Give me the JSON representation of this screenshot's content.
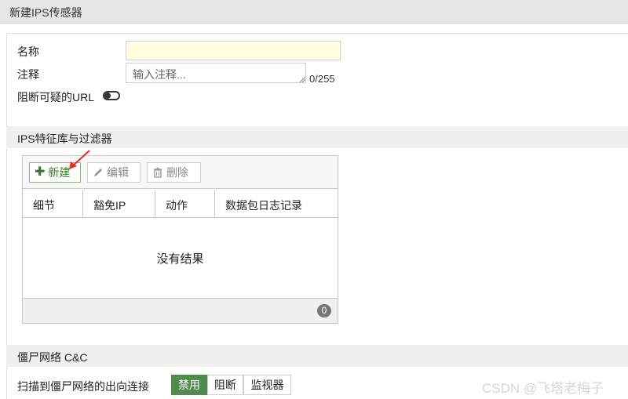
{
  "header": {
    "title": "新建IPS传感器"
  },
  "form": {
    "name_label": "名称",
    "name_value": "",
    "comment_label": "注释",
    "comment_placeholder": "输入注释...",
    "comment_counter": "0/255",
    "block_url_label": "阻断可疑的URL",
    "block_url_enabled": false
  },
  "ips_section": {
    "title": "IPS特征库与过滤器",
    "toolbar": {
      "new_label": "新建",
      "edit_label": "编辑",
      "delete_label": "删除"
    },
    "columns": [
      "细节",
      "豁免IP",
      "动作",
      "数据包日志记录"
    ],
    "rows": [],
    "empty_text": "没有结果",
    "count": "0"
  },
  "botnet_section": {
    "title": "僵尸网络 C&C",
    "scan_label": "扫描到僵尸网络的出向连接",
    "options": [
      "禁用",
      "阻断",
      "监视器"
    ],
    "selected": "禁用"
  },
  "watermark": "CSDN @飞塔老梅子",
  "colors": {
    "accent_green": "#4f8a4f",
    "name_field_bg": "#ffffe0",
    "annotation_arrow": "#e03020"
  }
}
